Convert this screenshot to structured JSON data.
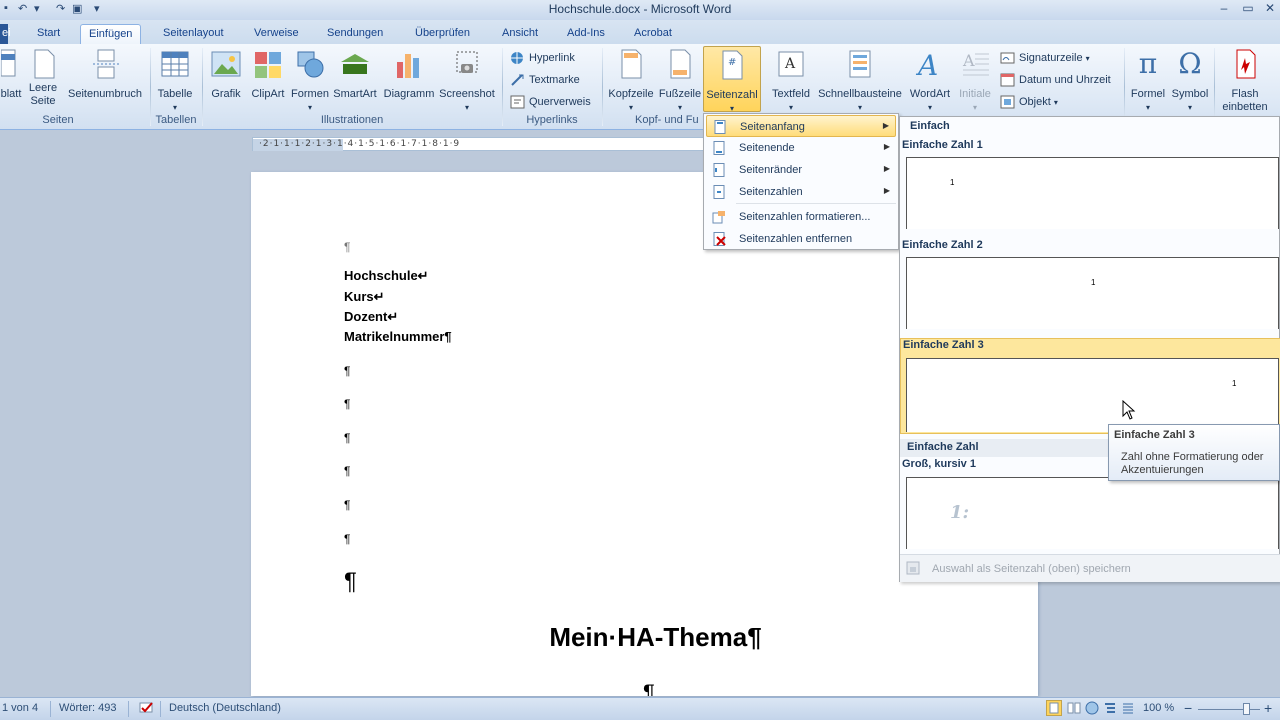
{
  "window": {
    "title": "Hochschule.docx - Microsoft Word",
    "minimize": "–",
    "restore": "▭",
    "close": "✕"
  },
  "tabs": {
    "file": "ei",
    "start": "Start",
    "einfuegen": "Einfügen",
    "seitenlayout": "Seitenlayout",
    "verweise": "Verweise",
    "sendungen": "Sendungen",
    "ueberpruefen": "Überprüfen",
    "ansicht": "Ansicht",
    "addins": "Add-Ins",
    "acrobat": "Acrobat"
  },
  "ribbon": {
    "seiten": {
      "deckblatt": "blatt",
      "leere_seite_1": "Leere",
      "leere_seite_2": "Seite",
      "seitenumbruch": "Seitenumbruch",
      "group": "Seiten"
    },
    "tabellen": {
      "tabelle": "Tabelle",
      "group": "Tabellen"
    },
    "illustrationen": {
      "grafik": "Grafik",
      "clipart": "ClipArt",
      "formen": "Formen",
      "smartart": "SmartArt",
      "diagramm": "Diagramm",
      "screenshot": "Screenshot",
      "group": "Illustrationen"
    },
    "hyperlinks": {
      "hyperlink": "Hyperlink",
      "textmarke": "Textmarke",
      "querverweis": "Querverweis",
      "group": "Hyperlinks"
    },
    "kopf": {
      "kopfzeile": "Kopfzeile",
      "fusszeile": "Fußzeile",
      "seitenzahl": "Seitenzahl",
      "group": "Kopf- und Fu"
    },
    "text": {
      "textfeld": "Textfeld",
      "schnellbausteine": "Schnellbausteine",
      "wordart": "WordArt",
      "initiale": "Initiale",
      "signaturzeile": "Signaturzeile",
      "datum": "Datum und Uhrzeit",
      "objekt": "Objekt"
    },
    "symbole": {
      "formel": "Formel",
      "symbol": "Symbol"
    },
    "flash": {
      "line1": "Flash",
      "line2": "einbetten"
    }
  },
  "ruler": {
    "ticks": "·2·1·1·1·2·1·3·1·4·1·5·1·6·1·7·1·8·1·9"
  },
  "document": {
    "lines": [
      "Hochschule↵",
      "Kurs↵",
      "Dozent↵",
      "Matrikelnummer¶"
    ],
    "pilcrow": "¶",
    "heading": "Mein·HA-Thema¶"
  },
  "menu": {
    "items": [
      "Seitenanfang",
      "Seitenende",
      "Seitenränder",
      "Seitenzahlen",
      "Seitenzahlen formatieren...",
      "Seitenzahlen entfernen"
    ],
    "arrow": "▶"
  },
  "gallery": {
    "section1": "Einfach",
    "item1": "Einfache Zahl 1",
    "item2": "Einfache Zahl 2",
    "item3": "Einfache Zahl 3",
    "section2": "Einfache Zahl",
    "item4": "Groß, kursiv 1",
    "num": "1",
    "big_num": "1:",
    "footer": "Auswahl als Seitenzahl (oben) speichern"
  },
  "tooltip": {
    "title": "Einfache Zahl 3",
    "desc": "Zahl ohne Formatierung oder Akzentuierungen"
  },
  "status": {
    "page": "1 von 4",
    "words": "Wörter: 493",
    "language": "Deutsch (Deutschland)",
    "zoom": "100 %",
    "zoom_out": "−",
    "zoom_in": "+"
  },
  "colors": {
    "accent": "#2b5797",
    "highlight": "#ffd45b"
  }
}
